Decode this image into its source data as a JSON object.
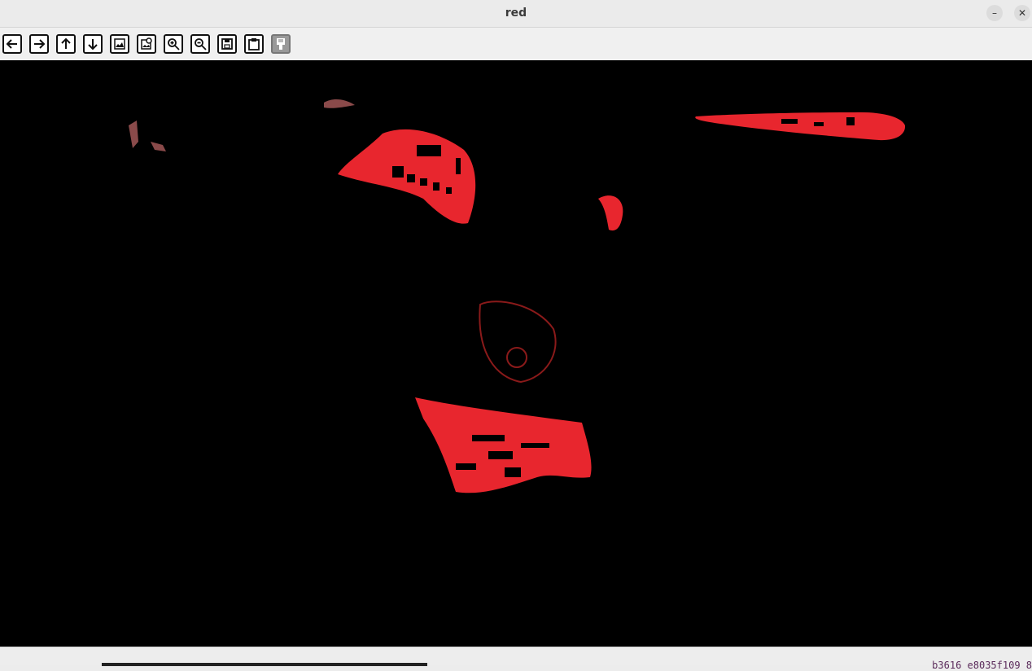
{
  "window": {
    "title": "red",
    "minimize_glyph": "–",
    "close_glyph": "✕"
  },
  "toolbar": {
    "buttons": [
      {
        "name": "pan-left-button",
        "icon": "arrow-left-icon"
      },
      {
        "name": "pan-right-button",
        "icon": "arrow-right-icon"
      },
      {
        "name": "pan-up-button",
        "icon": "arrow-up-icon"
      },
      {
        "name": "pan-down-button",
        "icon": "arrow-down-icon"
      },
      {
        "name": "zoom-fit-button",
        "icon": "image-icon"
      },
      {
        "name": "zoom-original-button",
        "icon": "image-zoom-icon"
      },
      {
        "name": "zoom-in-button",
        "icon": "zoom-in-icon"
      },
      {
        "name": "zoom-out-button",
        "icon": "zoom-out-icon"
      },
      {
        "name": "save-button",
        "icon": "save-icon"
      },
      {
        "name": "copy-button",
        "icon": "clipboard-icon"
      },
      {
        "name": "properties-button",
        "icon": "paint-brush-icon"
      }
    ]
  },
  "image": {
    "background": "#000000",
    "highlight_color": "#e8262e",
    "content": "red-mask-baseball-player"
  },
  "status": {
    "text": "b3616 e8035f109 8"
  }
}
